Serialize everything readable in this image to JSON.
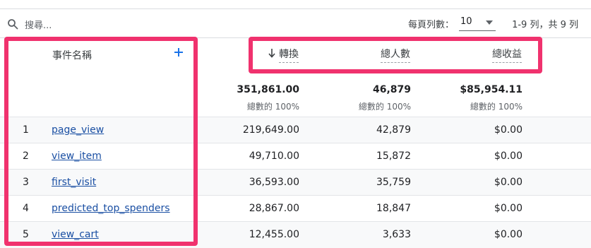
{
  "toolbar": {
    "search_placeholder": "搜尋...",
    "rows_per_page_label": "每頁列數：",
    "rows_per_page_value": "10",
    "pagination": "1-9 列，共 9 列"
  },
  "columns": {
    "event_name": "事件名稱",
    "conversions": "轉換",
    "total_users": "總人數",
    "total_revenue": "總收益"
  },
  "totals": {
    "conversions": "351,861.00",
    "conversions_sub": "總數的 100%",
    "users": "46,879",
    "users_sub": "總數的 100%",
    "revenue": "$85,954.11",
    "revenue_sub": "總數的 100%"
  },
  "rows": [
    {
      "index": "1",
      "name": "page_view",
      "conversions": "219,649.00",
      "users": "42,879",
      "revenue": "$0.00"
    },
    {
      "index": "2",
      "name": "view_item",
      "conversions": "49,710.00",
      "users": "15,872",
      "revenue": "$0.00"
    },
    {
      "index": "3",
      "name": "first_visit",
      "conversions": "36,593.00",
      "users": "35,759",
      "revenue": "$0.00"
    },
    {
      "index": "4",
      "name": "predicted_top_spenders",
      "conversions": "28,867.00",
      "users": "18,847",
      "revenue": "$0.00"
    },
    {
      "index": "5",
      "name": "view_cart",
      "conversions": "12,455.00",
      "users": "3,633",
      "revenue": "$0.00"
    }
  ],
  "colors": {
    "highlight": "#f0326e",
    "link": "#1a4fa3",
    "accent": "#1a73e8"
  },
  "icons": {
    "search": "search-icon",
    "add": "plus-icon",
    "sort": "arrow-down-icon",
    "dropdown": "caret-down-icon"
  }
}
